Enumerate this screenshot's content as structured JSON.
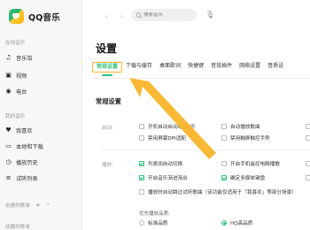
{
  "app": {
    "name": "QQ音乐"
  },
  "sidebar": {
    "section_online": "在线音乐",
    "online_items": [
      {
        "label": "音乐馆",
        "icon": "music-note-icon"
      },
      {
        "label": "视频",
        "icon": "video-icon"
      },
      {
        "label": "电台",
        "icon": "radio-icon"
      }
    ],
    "section_mine": "我的音乐",
    "mine_items": [
      {
        "label": "我喜欢",
        "icon": "heart-icon"
      },
      {
        "label": "本地和下载",
        "icon": "computer-icon"
      },
      {
        "label": "播放历史",
        "icon": "history-icon"
      },
      {
        "label": "试听列表",
        "icon": "list-icon"
      }
    ],
    "created_playlists": "创建的歌单",
    "collected_playlists": "收藏的歌单"
  },
  "topbar": {
    "search_placeholder": "搜索音乐"
  },
  "settings": {
    "title": "设置",
    "tabs": [
      {
        "label": "常规设置",
        "active": true
      },
      {
        "label": "下载与缓存",
        "active": false
      },
      {
        "label": "桌面歌词",
        "active": false
      },
      {
        "label": "快捷键",
        "active": false
      },
      {
        "label": "音效插件",
        "active": false
      },
      {
        "label": "网络设置",
        "active": false
      },
      {
        "label": "音质设",
        "active": false
      }
    ],
    "group_title": "常规设置",
    "startup": {
      "label": "启动:",
      "options": [
        {
          "label": "开机自动启动QQ音乐",
          "checked": false
        },
        {
          "label": "自动播放歌曲",
          "checked": false
        },
        {
          "label": "禁用屏幕DPI适配",
          "checked": false
        },
        {
          "label": "禁用触屏触控手势",
          "checked": false
        }
      ]
    },
    "playback": {
      "label": "播放:",
      "options": [
        {
          "label": "列表间自动切换",
          "checked": true
        },
        {
          "label": "开启手机遥控电脑播歌",
          "checked": false
        },
        {
          "label": "开启音乐渐进渐出",
          "checked": true
        },
        {
          "label": "确定多媒体键盘",
          "checked": true
        },
        {
          "label": "播放时自动跳过试听歌曲（该功能仅适用于「我喜欢」等部分场景）",
          "checked": false
        }
      ],
      "quality_label": "优先播放品质:",
      "quality_options": [
        {
          "label": "标准品质",
          "checked": false
        },
        {
          "label": "HQ高品质",
          "checked": true
        }
      ]
    }
  },
  "colors": {
    "accent": "#31c27c",
    "highlight": "#f9b52a"
  }
}
